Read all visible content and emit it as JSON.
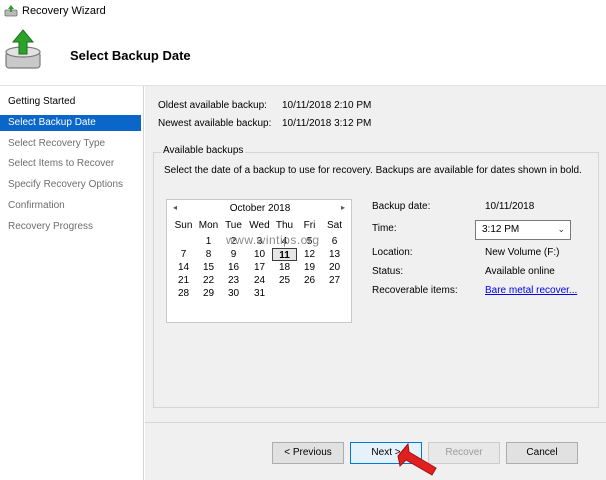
{
  "window": {
    "title": "Recovery Wizard"
  },
  "header": {
    "page_title": "Select Backup Date"
  },
  "sidebar": {
    "steps": [
      {
        "label": "Getting Started"
      },
      {
        "label": "Select Backup Date"
      },
      {
        "label": "Select Recovery Type"
      },
      {
        "label": "Select Items to Recover"
      },
      {
        "label": "Specify Recovery Options"
      },
      {
        "label": "Confirmation"
      },
      {
        "label": "Recovery Progress"
      }
    ]
  },
  "main": {
    "oldest_label": "Oldest available backup:",
    "oldest_value": "10/11/2018 2:10 PM",
    "newest_label": "Newest available backup:",
    "newest_value": "10/11/2018 3:12 PM",
    "group_title": "Available backups",
    "group_desc": "Select the date of a backup to use for recovery. Backups are available for dates shown in bold.",
    "calendar": {
      "month": "October 2018",
      "prev": "◂",
      "next": "▸",
      "dow": [
        "Sun",
        "Mon",
        "Tue",
        "Wed",
        "Thu",
        "Fri",
        "Sat"
      ],
      "rows": [
        [
          "",
          "1",
          "2",
          "3",
          "4",
          "5",
          "6"
        ],
        [
          "7",
          "8",
          "9",
          "10",
          "11",
          "12",
          "13"
        ],
        [
          "14",
          "15",
          "16",
          "17",
          "18",
          "19",
          "20"
        ],
        [
          "21",
          "22",
          "23",
          "24",
          "25",
          "26",
          "27"
        ],
        [
          "28",
          "29",
          "30",
          "31",
          "",
          "",
          ""
        ]
      ],
      "selected_day": "11"
    },
    "details": {
      "backup_date_label": "Backup date:",
      "backup_date_value": "10/11/2018",
      "time_label": "Time:",
      "time_value": "3:12 PM",
      "location_label": "Location:",
      "location_value": "New Volume (F:)",
      "status_label": "Status:",
      "status_value": "Available online",
      "recoverable_label": "Recoverable items:",
      "recoverable_link": "Bare metal recover..."
    },
    "watermark": "www.wintips.org"
  },
  "buttons": {
    "previous": "< Previous",
    "next": "Next >",
    "recover": "Recover",
    "cancel": "Cancel"
  },
  "icons": {
    "app_icon": "recovery-wizard-icon",
    "header_icon": "disk-recovery-icon",
    "arrow": "red-pointer-arrow-icon"
  },
  "colors": {
    "active_step": "#0a66c8",
    "link": "#0000ee",
    "pointer_arrow": "#e0201f"
  }
}
